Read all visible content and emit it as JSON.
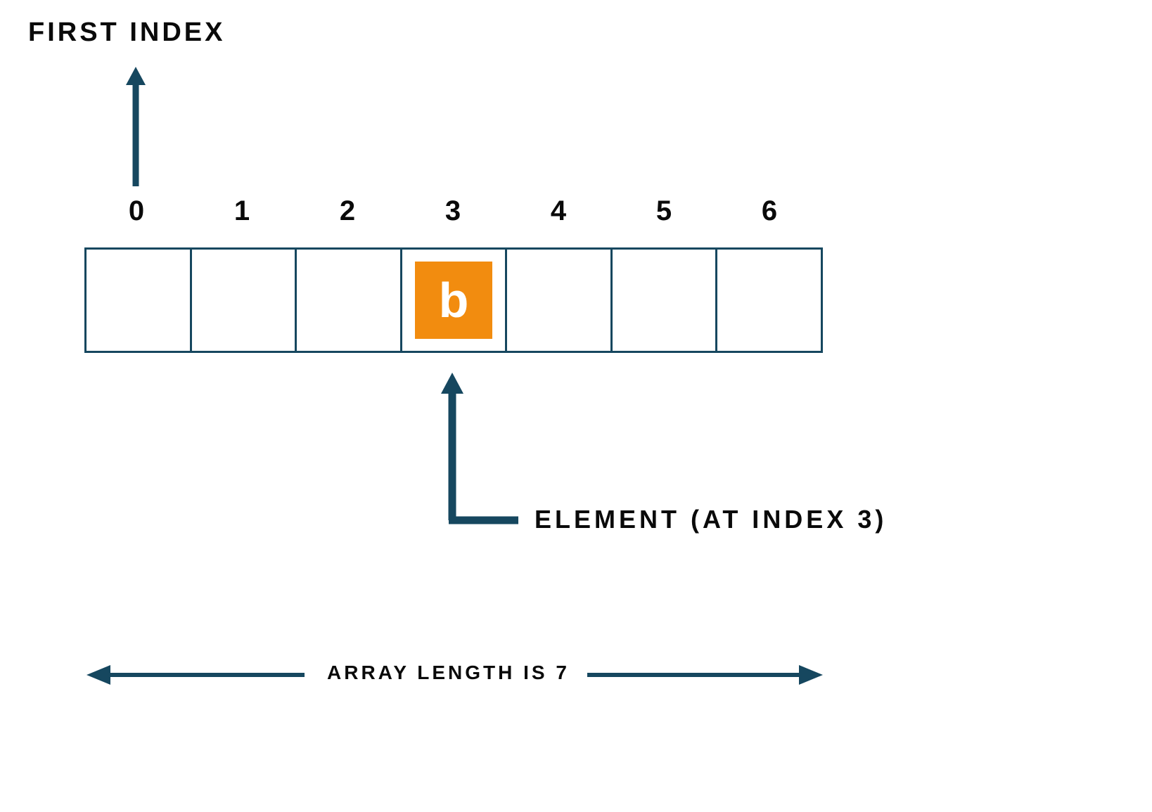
{
  "labels": {
    "first_index": "FIRST INDEX",
    "element_at_index": "ELEMENT (AT INDEX 3)",
    "array_length": "ARRAY LENGTH IS 7"
  },
  "indices": [
    "0",
    "1",
    "2",
    "3",
    "4",
    "5",
    "6"
  ],
  "highlighted_element": {
    "index": 3,
    "value": "b"
  },
  "colors": {
    "border": "#16475f",
    "highlight": "#f28c0f",
    "text": "#0a0a0a"
  }
}
